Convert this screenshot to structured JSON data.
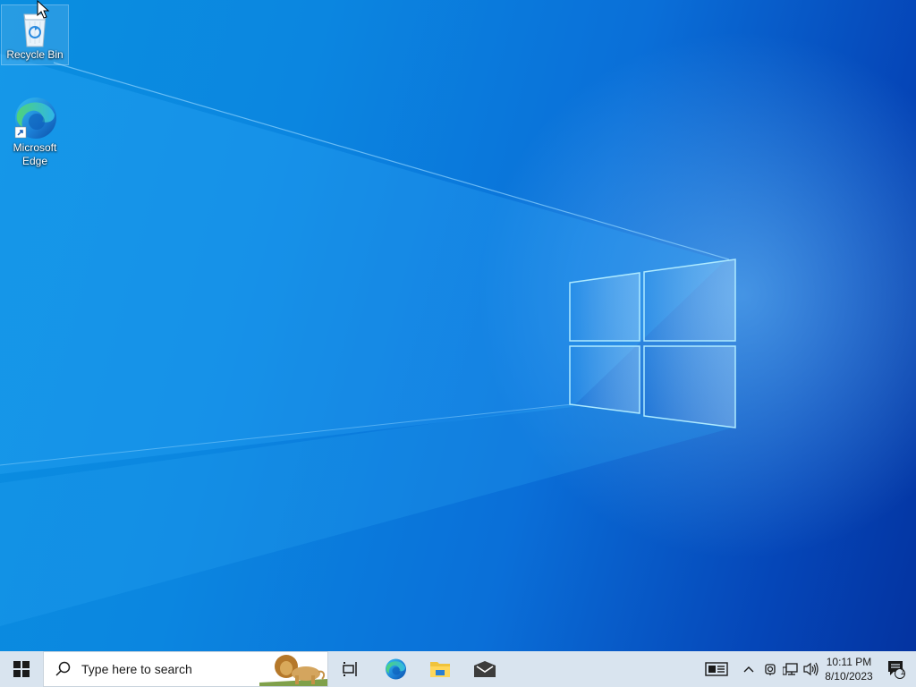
{
  "desktop": {
    "icons": [
      {
        "label": "Recycle Bin",
        "icon": "recycle-bin-icon"
      },
      {
        "label": "Microsoft\nEdge",
        "icon": "edge-icon"
      }
    ]
  },
  "taskbar": {
    "start_icon": "windows-logo-icon",
    "search": {
      "placeholder": "Type here to search",
      "icon": "search-icon",
      "highlight_icon": "lion-search-highlight-icon"
    },
    "apps": [
      {
        "name": "Task View",
        "icon": "task-view-icon"
      },
      {
        "name": "Microsoft Edge",
        "icon": "edge-icon"
      },
      {
        "name": "File Explorer",
        "icon": "folder-icon"
      },
      {
        "name": "Mail",
        "icon": "mail-icon"
      }
    ],
    "tray": {
      "icons": [
        "news-widget-icon",
        "chevron-up-icon",
        "camera-icon",
        "network-icon",
        "volume-icon"
      ],
      "time": "10:11 PM",
      "date": "8/10/2023",
      "notification_count": "1",
      "notification_icon": "action-center-icon"
    }
  },
  "colors": {
    "taskbar_bg": "#d9e4ef",
    "wallpaper_light": "#0a8fe0",
    "wallpaper_dark": "#0433a0"
  }
}
